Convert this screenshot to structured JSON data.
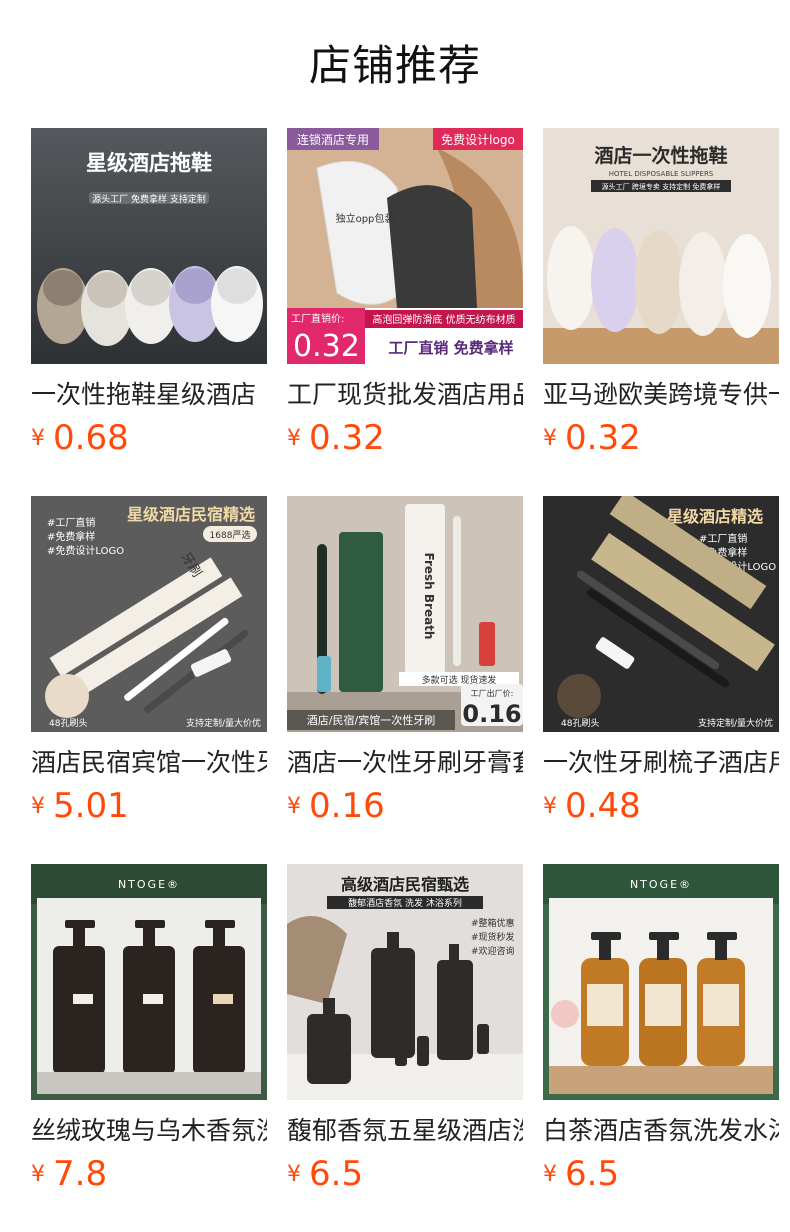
{
  "page": {
    "title": "店铺推荐"
  },
  "currency_symbol": "¥",
  "products": [
    {
      "name": "一次性拖鞋星级酒店",
      "price": "0.68",
      "image": {
        "icon": "slipper-icon",
        "background": "#3f4347",
        "accent": "#b8a996",
        "headline": "星级酒店拖鞋",
        "tags": "源头工厂  免费拿样  支持定制"
      }
    },
    {
      "name": "工厂现货批发酒店用品",
      "price": "0.32",
      "image": {
        "icon": "slipper-icon",
        "background": "#d9b99a",
        "accent": "#2f2f2f",
        "badge_left": "连锁酒店专用",
        "badge_right": "免费设计logo",
        "inner_label": "独立opp包装",
        "promo_label": "工厂直销价:",
        "promo_price": "0.32",
        "footer_top": "高泡回弹防滑底  优质无纺布材质",
        "footer_bottom": "工厂直销 免费拿样"
      }
    },
    {
      "name": "亚马逊欧美跨境专供一次性拖鞋",
      "price": "0.32",
      "image": {
        "icon": "slipper-icon",
        "background": "#e9ded5",
        "accent": "#f2ede6",
        "headline": "酒店一次性拖鞋",
        "sub_headline": "HOTEL DISPOSABLE SLIPPERS",
        "tags": "源头工厂  跨境专卖  支持定制  免费拿样"
      }
    },
    {
      "name": "酒店民宿宾馆一次性牙刷",
      "price": "5.01",
      "image": {
        "icon": "toothbrush-icon",
        "background": "#5a5a5a",
        "accent": "#f0eadf",
        "headline": "星级酒店民宿精选",
        "hashtags": [
          "#工厂直销",
          "#免费拿样",
          "#免费设计LOGO"
        ],
        "badge": "1688严选",
        "box_text": "牙刷",
        "corner_left": "48孔刷头",
        "corner_right": "支持定制/量大价优"
      }
    },
    {
      "name": "酒店一次性牙刷牙膏套装",
      "price": "0.16",
      "image": {
        "icon": "toothbrush-icon",
        "background": "#cfc6bd",
        "accent": "#2f5b41",
        "box_text": "Fresh Breath",
        "tags_top": "多款可选 现货速发",
        "promo_label": "工厂出厂价:",
        "promo_price": "0.16",
        "footer": "酒店/民宿/宾馆一次性牙刷"
      }
    },
    {
      "name": "一次性牙刷梳子酒店用品",
      "price": "0.48",
      "image": {
        "icon": "toothbrush-icon",
        "background": "#2e2e2e",
        "accent": "#c8b68c",
        "headline": "星级酒店精选",
        "hashtags": [
          "#工厂直销",
          "#免费拿样",
          "#免费设计LOGO"
        ],
        "corner_left": "48孔刷头",
        "corner_right": "支持定制/量大价优"
      }
    },
    {
      "name": "丝绒玫瑰与乌木香氛洗护",
      "price": "7.8",
      "image": {
        "icon": "bottle-icon",
        "background": "#3c5a44",
        "accent": "#2a2320",
        "brand": "NTOGE®"
      }
    },
    {
      "name": "馥郁香氛五星级酒店洗护",
      "price": "6.5",
      "image": {
        "icon": "bottle-icon",
        "background": "#dedad6",
        "accent": "#2e2b29",
        "headline": "高级酒店民宿甄选",
        "sub_headline": "馥郁酒店香氛 洗发 沐浴系列",
        "hashtags": [
          "#整箱优惠",
          "#现货秒发",
          "#欢迎咨询"
        ]
      }
    },
    {
      "name": "白茶酒店香氛洗发水沐浴露",
      "price": "6.5",
      "image": {
        "icon": "bottle-icon",
        "background": "#cfe0d0",
        "accent": "#b8731e",
        "brand": "NTOGE®"
      }
    }
  ]
}
